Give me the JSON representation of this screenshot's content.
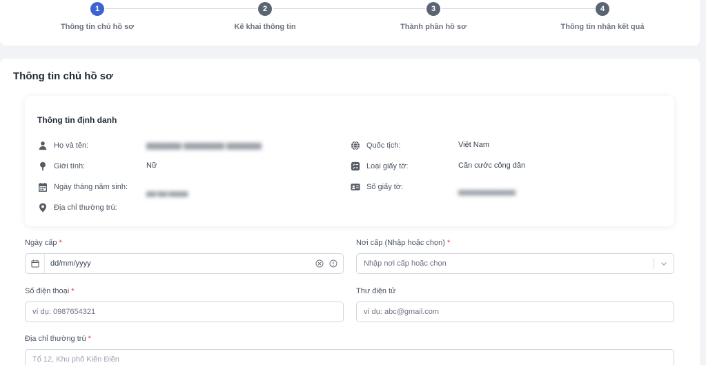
{
  "stepper": {
    "steps": [
      {
        "number": "1",
        "label": "Thông tin chủ hồ sơ",
        "active": true
      },
      {
        "number": "2",
        "label": "Kê khai thông tin",
        "active": false
      },
      {
        "number": "3",
        "label": "Thành phần hồ sơ",
        "active": false
      },
      {
        "number": "4",
        "label": "Thông tin nhận kết quả",
        "active": false
      }
    ]
  },
  "section": {
    "title": "Thông tin chủ hồ sơ"
  },
  "identity": {
    "title": "Thông tin định danh",
    "left": [
      {
        "icon": "user-icon",
        "label": "Họ và tên:",
        "value": "",
        "blurred": true
      },
      {
        "icon": "gender-icon",
        "label": "Giới tính:",
        "value": "Nữ",
        "blurred": false
      },
      {
        "icon": "calendar-icon",
        "label": "Ngày tháng năm sinh:",
        "value": "",
        "blurred": true
      },
      {
        "icon": "location-pin-icon",
        "label": "Địa chỉ thường trú:",
        "value": "",
        "blurred": false
      }
    ],
    "right": [
      {
        "icon": "globe-icon",
        "label": "Quốc tịch:",
        "value": "Việt Nam",
        "blurred": false
      },
      {
        "icon": "document-list-icon",
        "label": "Loại giấy tờ:",
        "value": "Căn cước công dân",
        "blurred": false
      },
      {
        "icon": "id-card-icon",
        "label": "Số giấy tờ:",
        "value": "",
        "blurred": true
      }
    ]
  },
  "form": {
    "issue_date": {
      "label": "Ngày cấp",
      "required_mark": "*",
      "placeholder": "dd/mm/yyyy"
    },
    "issue_place": {
      "label": "Nơi cấp (Nhập hoặc chọn)",
      "required_mark": "*",
      "placeholder": "Nhập nơi cấp hoặc chọn"
    },
    "phone": {
      "label": "Số điện thoại",
      "required_mark": "*",
      "placeholder": "ví dụ: 0987654321"
    },
    "email": {
      "label": "Thư điện tử",
      "placeholder": "ví dụ: abc@gmail.com"
    },
    "address": {
      "label": "Địa chỉ thường trú",
      "required_mark": "*",
      "placeholder": "Tổ 12, Khu phố Kiến Điền"
    }
  },
  "colors": {
    "accent": "#3d63d2",
    "required": "#e03131"
  }
}
